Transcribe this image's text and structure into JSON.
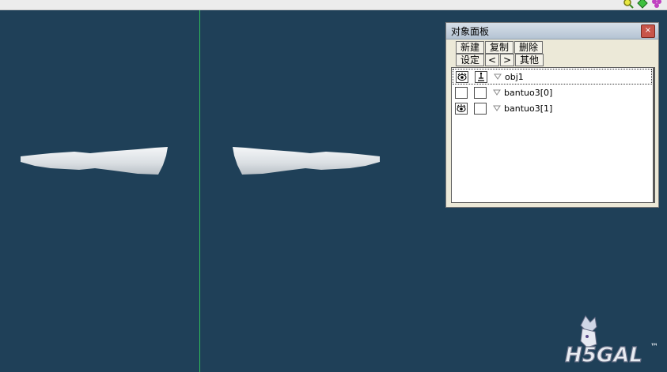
{
  "colors": {
    "viewport_bg": "#1f4058",
    "axis": "#2fbf5a",
    "mesh": "#e8ecef"
  },
  "topbar": {
    "icons": [
      "search-icon",
      "diamond-icon",
      "molecule-icon"
    ]
  },
  "panel": {
    "title": "对象面板",
    "close_label": "×",
    "toolbar_row1": [
      "新建",
      "复制",
      "删除"
    ],
    "toolbar_row2": [
      "设定",
      "<",
      ">",
      "其他"
    ],
    "objects": [
      {
        "name": "obj1",
        "visible_icon": true,
        "lock_icon": true,
        "selected": true
      },
      {
        "name": "bantuo3[0]",
        "visible_icon": false,
        "lock_icon": false,
        "selected": false
      },
      {
        "name": "bantuo3[1]",
        "visible_icon": true,
        "lock_icon": false,
        "selected": false
      }
    ]
  },
  "watermark": {
    "text": "H5GAL",
    "tm": "™"
  }
}
